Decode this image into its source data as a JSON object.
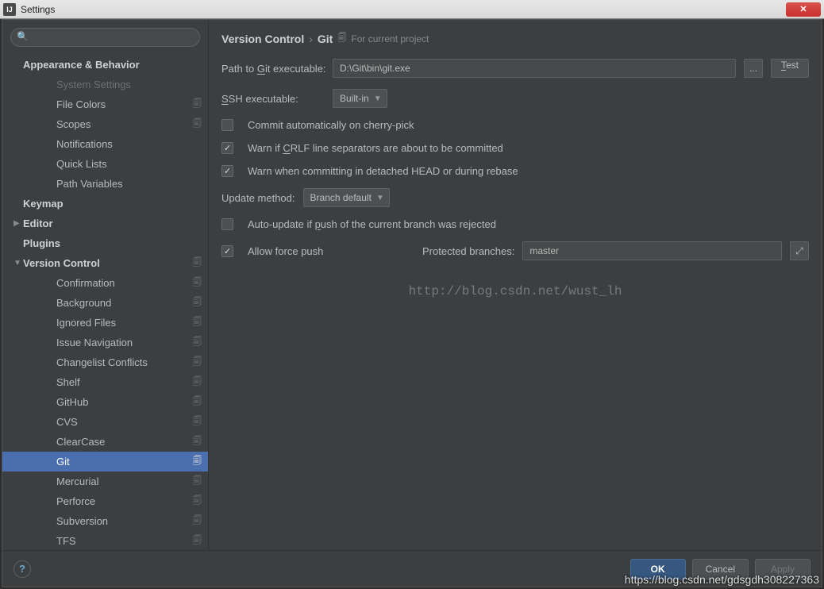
{
  "window": {
    "title": "Settings",
    "app_icon_text": "IJ"
  },
  "search": {
    "placeholder": ""
  },
  "sidebar": {
    "items": [
      {
        "label": "Appearance & Behavior",
        "bold": true,
        "indent": 0,
        "arrow": "",
        "copy": false
      },
      {
        "label": "System Settings",
        "bold": false,
        "indent": 2,
        "arrow": "",
        "copy": false,
        "dim": true
      },
      {
        "label": "File Colors",
        "bold": false,
        "indent": 2,
        "arrow": "",
        "copy": true
      },
      {
        "label": "Scopes",
        "bold": false,
        "indent": 2,
        "arrow": "",
        "copy": true
      },
      {
        "label": "Notifications",
        "bold": false,
        "indent": 2,
        "arrow": "",
        "copy": false
      },
      {
        "label": "Quick Lists",
        "bold": false,
        "indent": 2,
        "arrow": "",
        "copy": false
      },
      {
        "label": "Path Variables",
        "bold": false,
        "indent": 2,
        "arrow": "",
        "copy": false
      },
      {
        "label": "Keymap",
        "bold": true,
        "indent": 0,
        "arrow": "",
        "copy": false
      },
      {
        "label": "Editor",
        "bold": true,
        "indent": 0,
        "arrow": "▶",
        "copy": false
      },
      {
        "label": "Plugins",
        "bold": true,
        "indent": 0,
        "arrow": "",
        "copy": false
      },
      {
        "label": "Version Control",
        "bold": true,
        "indent": 0,
        "arrow": "▼",
        "copy": true
      },
      {
        "label": "Confirmation",
        "bold": false,
        "indent": 2,
        "arrow": "",
        "copy": true
      },
      {
        "label": "Background",
        "bold": false,
        "indent": 2,
        "arrow": "",
        "copy": true
      },
      {
        "label": "Ignored Files",
        "bold": false,
        "indent": 2,
        "arrow": "",
        "copy": true
      },
      {
        "label": "Issue Navigation",
        "bold": false,
        "indent": 2,
        "arrow": "",
        "copy": true
      },
      {
        "label": "Changelist Conflicts",
        "bold": false,
        "indent": 2,
        "arrow": "",
        "copy": true
      },
      {
        "label": "Shelf",
        "bold": false,
        "indent": 2,
        "arrow": "",
        "copy": true
      },
      {
        "label": "GitHub",
        "bold": false,
        "indent": 2,
        "arrow": "",
        "copy": true
      },
      {
        "label": "CVS",
        "bold": false,
        "indent": 2,
        "arrow": "",
        "copy": true
      },
      {
        "label": "ClearCase",
        "bold": false,
        "indent": 2,
        "arrow": "",
        "copy": true
      },
      {
        "label": "Git",
        "bold": false,
        "indent": 2,
        "arrow": "",
        "copy": true,
        "selected": true
      },
      {
        "label": "Mercurial",
        "bold": false,
        "indent": 2,
        "arrow": "",
        "copy": true
      },
      {
        "label": "Perforce",
        "bold": false,
        "indent": 2,
        "arrow": "",
        "copy": true
      },
      {
        "label": "Subversion",
        "bold": false,
        "indent": 2,
        "arrow": "",
        "copy": true
      },
      {
        "label": "TFS",
        "bold": false,
        "indent": 2,
        "arrow": "",
        "copy": true
      }
    ]
  },
  "breadcrumb": {
    "root": "Version Control",
    "sep": "›",
    "leaf": "Git",
    "scope": "For current project"
  },
  "form": {
    "path_label_pre": "Path to ",
    "path_label_u": "G",
    "path_label_post": "it executable:",
    "path_value": "D:\\Git\\bin\\git.exe",
    "browse": "...",
    "test_u": "T",
    "test_post": "est",
    "ssh_label_u": "S",
    "ssh_label_post": "SH executable:",
    "ssh_value": "Built-in",
    "chk_cherry": "Commit automatically on cherry-pick",
    "chk_crlf_pre": "Warn if ",
    "chk_crlf_u": "C",
    "chk_crlf_post": "RLF line separators are about to be committed",
    "chk_detached": "Warn when committing in detached HEAD or during rebase",
    "update_label": "Update method:",
    "update_value": "Branch default",
    "chk_autoupdate_pre": "Auto-update if ",
    "chk_autoupdate_u": "p",
    "chk_autoupdate_post": "ush of the current branch was rejected",
    "chk_force": "Allow force push",
    "protected_label": "Protected branches:",
    "protected_value": "master"
  },
  "watermark": "http://blog.csdn.net/wust_lh",
  "buttons": {
    "ok": "OK",
    "cancel": "Cancel",
    "apply": "Apply",
    "help": "?"
  },
  "footer_url": "https://blog.csdn.net/gdsgdh308227363"
}
